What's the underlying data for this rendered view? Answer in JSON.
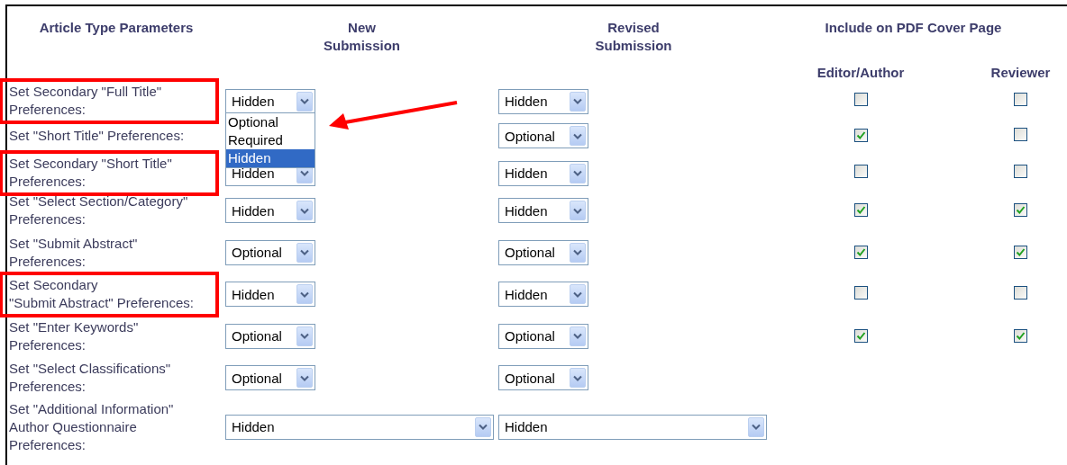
{
  "header": {
    "parameters": "Article Type Parameters",
    "new_submission": "New Submission",
    "revised_submission": "Revised Submission",
    "pdf_cover": "Include on PDF Cover Page",
    "editor_author": "Editor/Author",
    "reviewer": "Reviewer"
  },
  "rows": [
    {
      "label": "Set Secondary \"Full Title\"\nPreferences:",
      "highlighted": true,
      "new": "Hidden",
      "revised": "Hidden",
      "wide": false,
      "editor": false,
      "reviewer": false
    },
    {
      "label": "Set \"Short Title\" Preferences:",
      "highlighted": false,
      "revised": "Optional",
      "wide": false,
      "editor": true,
      "reviewer": false
    },
    {
      "label": "Set Secondary \"Short Title\"\nPreferences:",
      "highlighted": true,
      "new": "Hidden",
      "revised": "Hidden",
      "wide": false,
      "editor": false,
      "reviewer": false
    },
    {
      "label": "Set \"Select Section/Category\"\nPreferences:",
      "highlighted": false,
      "new": "Hidden",
      "revised": "Hidden",
      "wide": false,
      "editor": true,
      "reviewer": true
    },
    {
      "label": "Set \"Submit Abstract\"\nPreferences:",
      "highlighted": false,
      "new": "Optional",
      "revised": "Optional",
      "wide": false,
      "editor": true,
      "reviewer": true
    },
    {
      "label": "Set Secondary\n\"Submit Abstract\" Preferences:",
      "highlighted": true,
      "new": "Hidden",
      "revised": "Hidden",
      "wide": false,
      "editor": false,
      "reviewer": false
    },
    {
      "label": "Set \"Enter Keywords\"\nPreferences:",
      "highlighted": false,
      "new": "Optional",
      "revised": "Optional",
      "wide": false,
      "editor": true,
      "reviewer": true
    },
    {
      "label": "Set \"Select Classifications\"\nPreferences:",
      "highlighted": false,
      "new": "Optional",
      "revised": "Optional",
      "wide": false
    },
    {
      "label": "Set \"Additional Information\"\nAuthor Questionnaire\nPreferences:",
      "highlighted": false,
      "new": "Hidden",
      "revised": "Hidden",
      "wide": true
    }
  ],
  "dropdown_list": {
    "options": [
      {
        "label": "Optional",
        "selected": false
      },
      {
        "label": "Required",
        "selected": false
      },
      {
        "label": "Hidden",
        "selected": true
      }
    ]
  }
}
